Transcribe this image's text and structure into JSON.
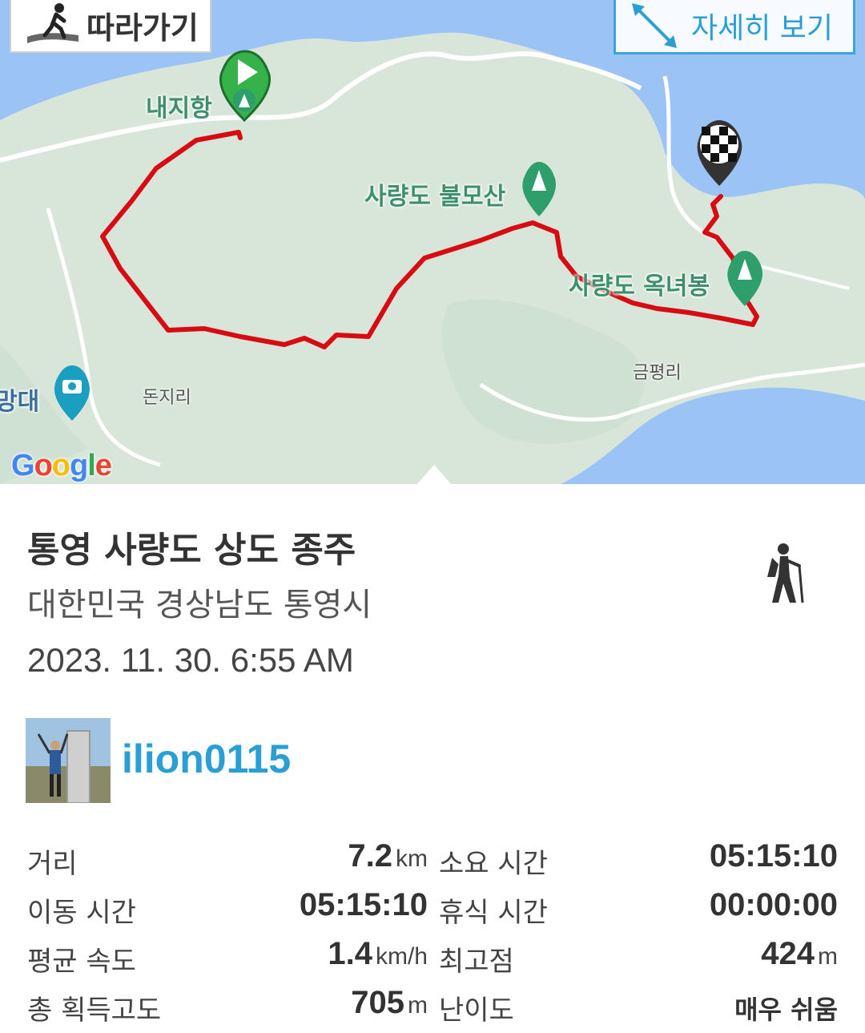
{
  "map": {
    "follow_label": "따라가기",
    "detail_label": "자세히 보기",
    "google_logo": [
      "G",
      "o",
      "o",
      "g",
      "l",
      "e"
    ],
    "google_colors": [
      "#4285F4",
      "#EA4335",
      "#FBBC05",
      "#4285F4",
      "#34A853",
      "#EA4335"
    ],
    "labels": {
      "naeji": "내지항",
      "bulmo": "사량도 불모산",
      "oknyeo": "사량도 옥녀봉",
      "geumpyeong": "금평리",
      "donji": "돈지리",
      "mangdae": "망대"
    },
    "colors": {
      "route": "#d90b12",
      "land": "#d8e6d9",
      "water": "#9cc3f5",
      "road": "#ffffff",
      "poi_green": "#2e9e6b",
      "start_green": "#35b34a"
    }
  },
  "info": {
    "title": "통영 사량도 상도 종주",
    "location": "대한민국 경상남도 통영시",
    "datetime": "2023. 11. 30. 6:55 AM",
    "username": "ilion0115",
    "activity_icon": "hiking-icon"
  },
  "stats": [
    {
      "label": "거리",
      "value": "7.2",
      "unit": "km",
      "label2": "소요 시간",
      "value2": "05:15:10",
      "unit2": ""
    },
    {
      "label": "이동 시간",
      "value": "05:15:10",
      "unit": "",
      "label2": "휴식 시간",
      "value2": "00:00:00",
      "unit2": ""
    },
    {
      "label": "평균 속도",
      "value": "1.4",
      "unit": "km/h",
      "label2": "최고점",
      "value2": "424",
      "unit2": "m"
    },
    {
      "label": "총 획득고도",
      "value": "705",
      "unit": "m",
      "label2": "난이도",
      "value2": "매우 쉬움",
      "unit2": ""
    }
  ]
}
